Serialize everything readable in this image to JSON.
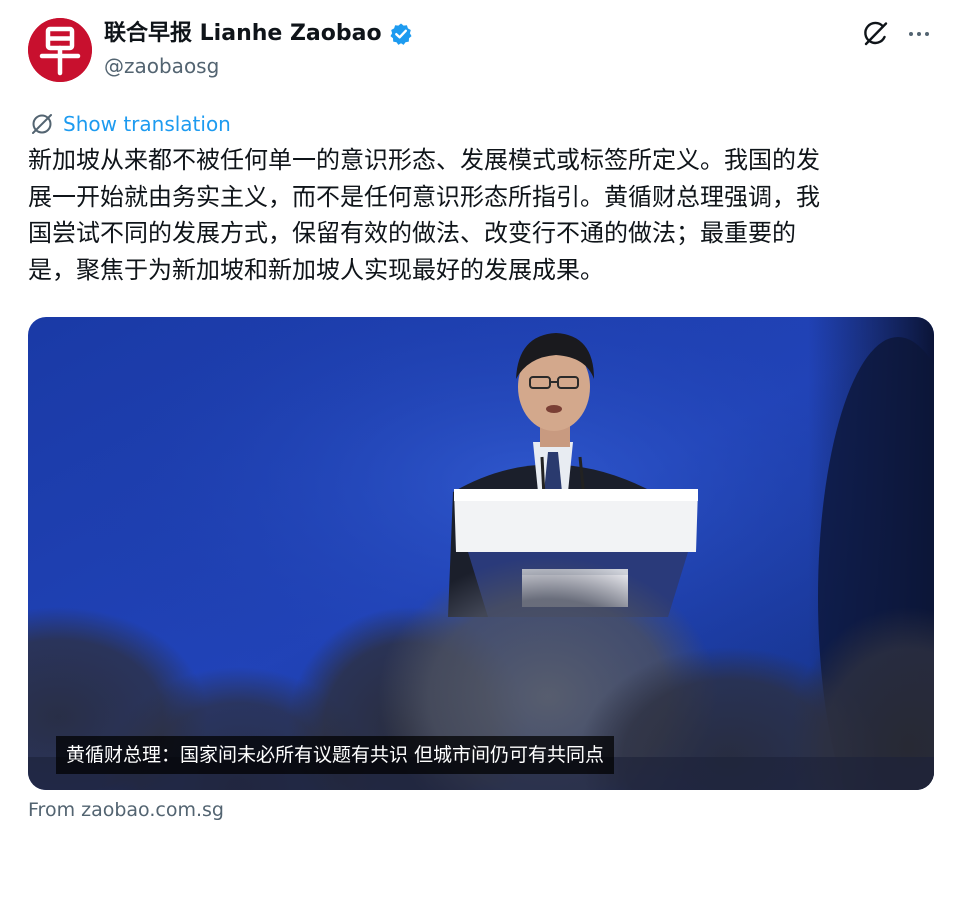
{
  "author": {
    "display_name": "联合早报 Lianhe Zaobao",
    "handle": "@zaobaosg",
    "avatar_glyph": "早",
    "avatar_color": "#c8102e",
    "verified_color": "#1d9bf0"
  },
  "actions": {
    "grok_icon": "grok-icon",
    "more_icon": "more-icon"
  },
  "translation": {
    "label": "Show translation",
    "icon": "globe-icon",
    "color": "#1d9bf0"
  },
  "tweet": {
    "lines": [
      "新加坡从来都不被任何单一的意识形态、发展模式或标签所定义。我国的发",
      "展一开始就由务实主义，而不是任何意识形态所指引。黄循财总理强调，我",
      "国尝试不同的发展方式，保留有效的做法、改变行不通的做法；最重要的",
      "是，聚焦于为新加坡和新加坡人实现最好的发展成果。"
    ]
  },
  "link_card": {
    "caption": "黄循财总理：国家间未必所有议题有共识 但城市间仍可有共同点",
    "source": "From zaobao.com.sg"
  }
}
